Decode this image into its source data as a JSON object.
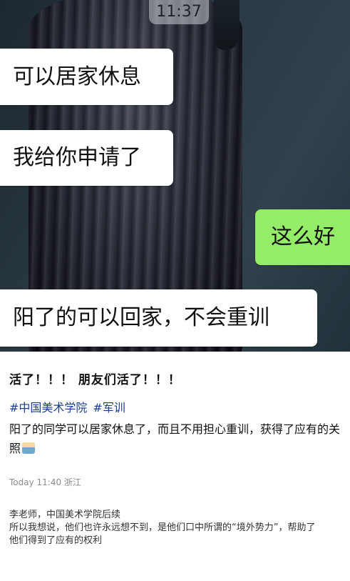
{
  "status": {
    "time": "11:37"
  },
  "chat": {
    "messages": [
      {
        "text": "可以居家休息",
        "side": "left"
      },
      {
        "text": "我给你申请了",
        "side": "left"
      },
      {
        "text": "这么好",
        "side": "right"
      },
      {
        "text": "阳了的可以回家，不会重训",
        "side": "left"
      }
    ]
  },
  "post": {
    "title": "活了！！！ 朋友们活了！！！",
    "tags": [
      "#中国美术学院",
      "#军训"
    ],
    "body": "阳了的同学可以居家休息了，而且不用担心重训，获得了应有的关照",
    "emoji": "hospital-emoji",
    "meta": "Today 11:40 浙江"
  },
  "comment": {
    "lines": [
      "李老师，中国美术学院后续",
      "所以我想说，他们也许永远想不到，是他们口中所谓的“境外势力”，帮助了",
      "他们得到了应有的权利"
    ]
  },
  "colors": {
    "accent_green": "#95ec69",
    "tag_blue": "#1a3e8c"
  }
}
